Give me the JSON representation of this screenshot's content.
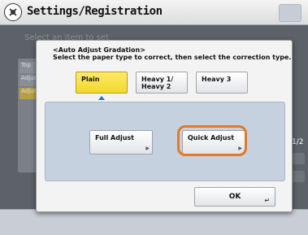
{
  "titlebar": {
    "title": "Settings/Registration",
    "icon": "settings-gear-icon"
  },
  "background": {
    "hint": "Select an item to set",
    "tabs": [
      "Top",
      "Adjus",
      "Adjus"
    ],
    "pager": "1/2"
  },
  "dialog": {
    "title": "<Auto Adjust Gradation>",
    "subtitle": "Select the paper type to correct, then select the correction type.",
    "paper_types": [
      {
        "label": "Plain",
        "selected": true
      },
      {
        "label": "Heavy 1/\nHeavy 2",
        "selected": false
      },
      {
        "label": "Heavy 3",
        "selected": false
      }
    ],
    "adjust": {
      "full_label": "Full Adjust",
      "quick_label": "Quick Adjust",
      "highlighted": "Quick Adjust"
    },
    "ok_label": "OK"
  },
  "colors": {
    "selected_yellow": "#f2d82a",
    "highlight_orange": "#e07a2a",
    "panel_blue": "#c6d1df"
  }
}
